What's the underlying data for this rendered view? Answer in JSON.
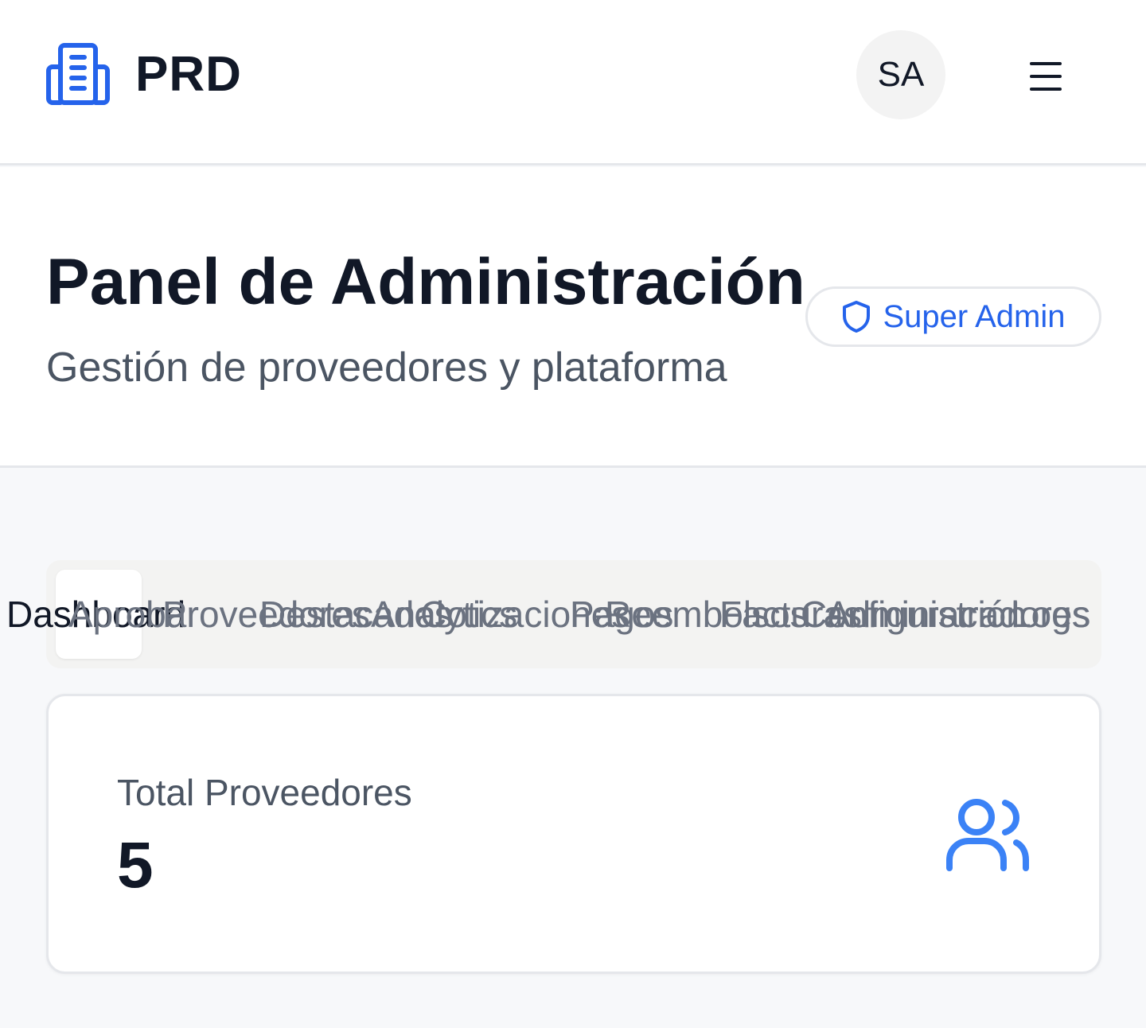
{
  "header": {
    "brand": "PRD",
    "logo_icon": "building-icon",
    "avatar_initials": "SA",
    "menu_icon": "hamburger-menu-icon"
  },
  "page": {
    "title": "Panel de Administración",
    "subtitle": "Gestión de proveedores y plataforma",
    "role_badge": "Super Admin",
    "role_badge_icon": "shield-icon"
  },
  "tabs": [
    {
      "label": "Dashboard",
      "active": true
    },
    {
      "label": "Aprobar",
      "active": false
    },
    {
      "label": "Proveedores",
      "active": false
    },
    {
      "label": "Destacados",
      "active": false
    },
    {
      "label": "Analytics",
      "active": false
    },
    {
      "label": "Cotizaciones",
      "active": false
    },
    {
      "label": "Pagos",
      "active": false
    },
    {
      "label": "Reembolsos",
      "active": false
    },
    {
      "label": "Facturas",
      "active": false
    },
    {
      "label": "Configuración",
      "active": false
    },
    {
      "label": "Administradores",
      "active": false
    },
    {
      "label": "Logs",
      "active": false
    }
  ],
  "stats": {
    "total_providers_label": "Total Proveedores",
    "total_providers_value": "5",
    "total_providers_icon": "users-icon"
  },
  "colors": {
    "accent": "#2563eb",
    "text_primary": "#111827",
    "text_secondary": "#4b5563",
    "border": "#e5e7eb"
  }
}
